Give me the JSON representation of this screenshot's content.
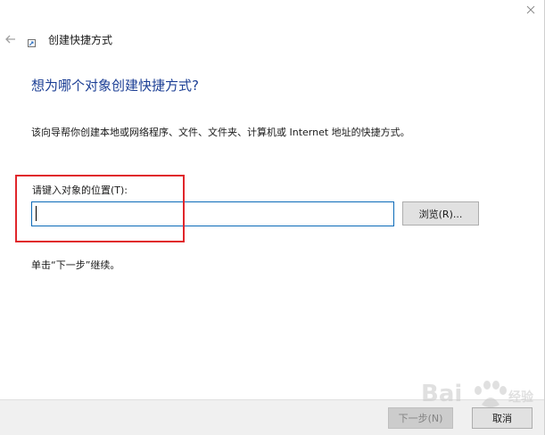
{
  "window": {
    "title": "创建快捷方式"
  },
  "page": {
    "heading": "想为哪个对象创建快捷方式?",
    "description": "该向导帮你创建本地或网络程序、文件、文件夹、计算机或 Internet 地址的快捷方式。",
    "location_label": "请键入对象的位置(T):",
    "location_value": "",
    "browse_label": "浏览(R)...",
    "hint": "单击“下一步”继续。"
  },
  "footer": {
    "next_label": "下一步(N)",
    "cancel_label": "取消"
  },
  "colors": {
    "heading": "#1c3f95",
    "highlight": "#e0262b",
    "input_border": "#0a6ab8"
  },
  "icons": {
    "back": "back-arrow-icon",
    "shortcut": "shortcut-icon",
    "close": "close-icon",
    "watermark": "baidu-logo-icon"
  }
}
